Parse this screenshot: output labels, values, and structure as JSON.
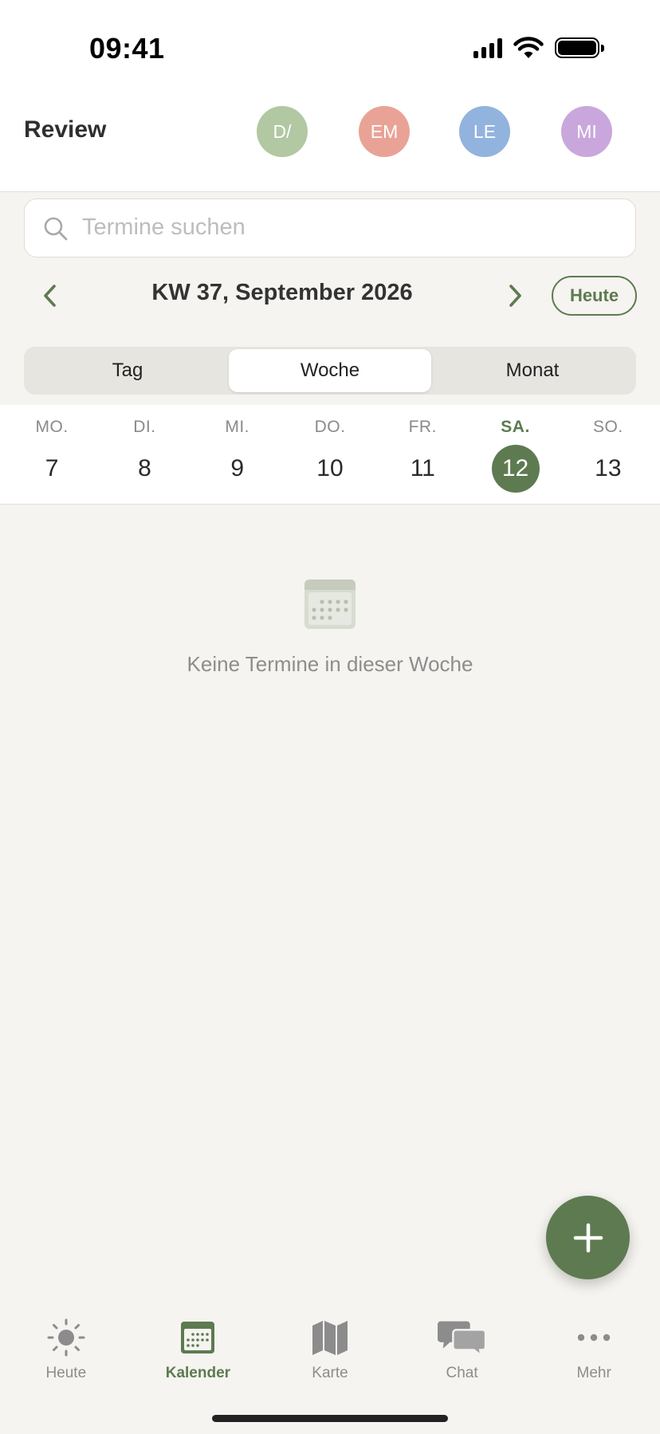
{
  "status_bar": {
    "time": "09:41"
  },
  "header": {
    "title": "Review",
    "avatars": [
      {
        "initials": "D/",
        "color": "#b1c8a3"
      },
      {
        "initials": "EM",
        "color": "#e9a396"
      },
      {
        "initials": "LE",
        "color": "#92b3de"
      },
      {
        "initials": "MI",
        "color": "#c9a7dc"
      }
    ]
  },
  "search": {
    "placeholder": "Termine suchen",
    "value": ""
  },
  "week_nav": {
    "label": "KW 37, September 2026",
    "today_label": "Heute",
    "prev_icon": "chevron-left-icon",
    "next_icon": "chevron-right-icon"
  },
  "view_switch": {
    "options": [
      "Tag",
      "Woche",
      "Monat"
    ],
    "selected": "Woche"
  },
  "days": [
    {
      "name": "MO.",
      "num": "7"
    },
    {
      "name": "DI.",
      "num": "8"
    },
    {
      "name": "MI.",
      "num": "9"
    },
    {
      "name": "DO.",
      "num": "10"
    },
    {
      "name": "FR.",
      "num": "11"
    },
    {
      "name": "SA.",
      "num": "12"
    },
    {
      "name": "SO.",
      "num": "13"
    }
  ],
  "selected_day": "12",
  "empty_state": {
    "text": "Keine Termine in dieser Woche",
    "icon": "calendar-icon"
  },
  "fab": {
    "icon": "plus-icon"
  },
  "tabs": [
    {
      "label": "Heute",
      "icon": "sun-icon"
    },
    {
      "label": "Kalender",
      "icon": "calendar-icon"
    },
    {
      "label": "Karte",
      "icon": "map-icon"
    },
    {
      "label": "Chat",
      "icon": "chat-icon"
    },
    {
      "label": "Mehr",
      "icon": "more-icon"
    }
  ],
  "active_tab": "Kalender",
  "colors": {
    "accent": "#5e7a51",
    "background": "#f5f4f0",
    "muted_text": "#8c8c8c"
  }
}
